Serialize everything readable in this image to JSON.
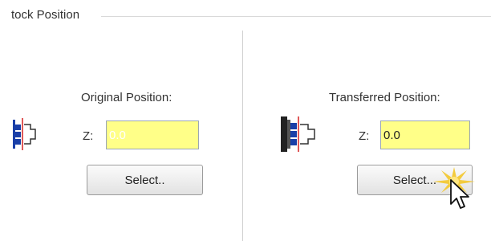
{
  "group": {
    "title": "tock Position"
  },
  "original": {
    "label": "Original Position:",
    "z_label": "Z:",
    "z_value": "0.0",
    "select_label": "Select.."
  },
  "transferred": {
    "label": "Transferred Position:",
    "z_label": "Z:",
    "z_value": "0.0",
    "select_label": "Select..."
  },
  "icons": {
    "original": "spindle-chuck-icon",
    "transferred": "sub-spindle-chuck-icon",
    "cursor": "mouse-pointer-icon",
    "click": "click-burst-icon"
  },
  "colors": {
    "field_background": "#ffff88",
    "selection": "#3a7bd5",
    "chuck_blue": "#1a3fa8",
    "marker_red": "#d62020"
  }
}
